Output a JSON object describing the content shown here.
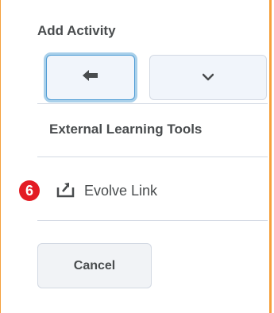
{
  "panel": {
    "title": "Add Activity"
  },
  "toolbar": {
    "back_icon": "back-arrow-icon",
    "dropdown_icon": "chevron-down-icon"
  },
  "section": {
    "heading": "External Learning Tools"
  },
  "badge": {
    "number": "6",
    "color": "#e31b23"
  },
  "tools": [
    {
      "label": "Evolve Link",
      "icon": "external-tool-insert-icon"
    }
  ],
  "footer": {
    "cancel_label": "Cancel"
  },
  "colors": {
    "frame_border": "#f5a03c",
    "focus_ring": "#a9d0ea",
    "text": "#494c4e"
  }
}
